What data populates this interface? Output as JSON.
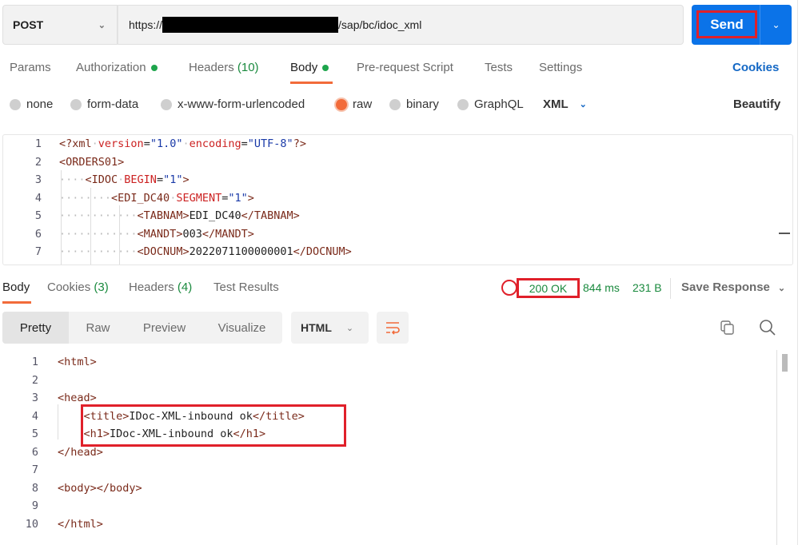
{
  "request": {
    "method": "POST",
    "url_prefix": "https://",
    "url_suffix": "/sap/bc/idoc_xml",
    "send_label": "Send"
  },
  "req_tabs": {
    "params": "Params",
    "authorization": "Authorization",
    "headers": "Headers",
    "headers_count": "(10)",
    "body": "Body",
    "prerequest": "Pre-request Script",
    "tests": "Tests",
    "settings": "Settings",
    "cookies": "Cookies"
  },
  "body_types": {
    "none": "none",
    "formdata": "form-data",
    "urlencoded": "x-www-form-urlencoded",
    "raw": "raw",
    "binary": "binary",
    "graphql": "GraphQL",
    "lang": "XML",
    "beautify": "Beautify",
    "selected": "raw"
  },
  "request_body": [
    [
      [
        "tg",
        "<?xml"
      ],
      [
        "ws",
        "·"
      ],
      [
        "at",
        "version"
      ],
      [
        "tx",
        "="
      ],
      [
        "st",
        "\"1.0\""
      ],
      [
        "ws",
        "·"
      ],
      [
        "at",
        "encoding"
      ],
      [
        "tx",
        "="
      ],
      [
        "st",
        "\"UTF-8\""
      ],
      [
        "tg",
        "?>"
      ]
    ],
    [
      [
        "tg",
        "<ORDERS01>"
      ]
    ],
    [
      [
        "ws",
        "····"
      ],
      [
        "tg",
        "<IDOC"
      ],
      [
        "ws",
        "·"
      ],
      [
        "at",
        "BEGIN"
      ],
      [
        "tx",
        "="
      ],
      [
        "st",
        "\"1\""
      ],
      [
        "tg",
        ">"
      ]
    ],
    [
      [
        "ws",
        "········"
      ],
      [
        "tg",
        "<EDI_DC40"
      ],
      [
        "ws",
        "·"
      ],
      [
        "at",
        "SEGMENT"
      ],
      [
        "tx",
        "="
      ],
      [
        "st",
        "\"1\""
      ],
      [
        "tg",
        ">"
      ]
    ],
    [
      [
        "ws",
        "············"
      ],
      [
        "tg",
        "<TABNAM>"
      ],
      [
        "tx",
        "EDI_DC40"
      ],
      [
        "tg",
        "</TABNAM>"
      ]
    ],
    [
      [
        "ws",
        "············"
      ],
      [
        "tg",
        "<MANDT>"
      ],
      [
        "tx",
        "003"
      ],
      [
        "tg",
        "</MANDT>"
      ]
    ],
    [
      [
        "ws",
        "············"
      ],
      [
        "tg",
        "<DOCNUM>"
      ],
      [
        "tx",
        "2022071100000001"
      ],
      [
        "tg",
        "</DOCNUM>"
      ]
    ]
  ],
  "response": {
    "tabs": {
      "body": "Body",
      "cookies": "Cookies",
      "cookies_count": "(3)",
      "headers": "Headers",
      "headers_count": "(4)",
      "tests": "Test Results"
    },
    "status": "200 OK",
    "time": "844 ms",
    "size": "231 B",
    "save": "Save Response",
    "views": [
      "Pretty",
      "Raw",
      "Preview",
      "Visualize"
    ],
    "format": "HTML"
  },
  "response_body": [
    [
      [
        "tg",
        "<html>"
      ]
    ],
    [],
    [
      [
        "tg",
        "<head>"
      ]
    ],
    [
      [
        "tx",
        "    "
      ],
      [
        "tg",
        "<title>"
      ],
      [
        "tx",
        "IDoc-XML-inbound ok"
      ],
      [
        "tg",
        "</title>"
      ]
    ],
    [
      [
        "tx",
        "    "
      ],
      [
        "tg",
        "<h1>"
      ],
      [
        "tx",
        "IDoc-XML-inbound ok"
      ],
      [
        "tg",
        "</h1>"
      ]
    ],
    [
      [
        "tg",
        "</head>"
      ]
    ],
    [],
    [
      [
        "tg",
        "<body></body>"
      ]
    ],
    [],
    [
      [
        "tg",
        "</html>"
      ]
    ]
  ],
  "colors": {
    "accent": "#f26b3a",
    "primary": "#0b73e8",
    "success": "#1a8a3e",
    "highlight": "#e0202a"
  }
}
